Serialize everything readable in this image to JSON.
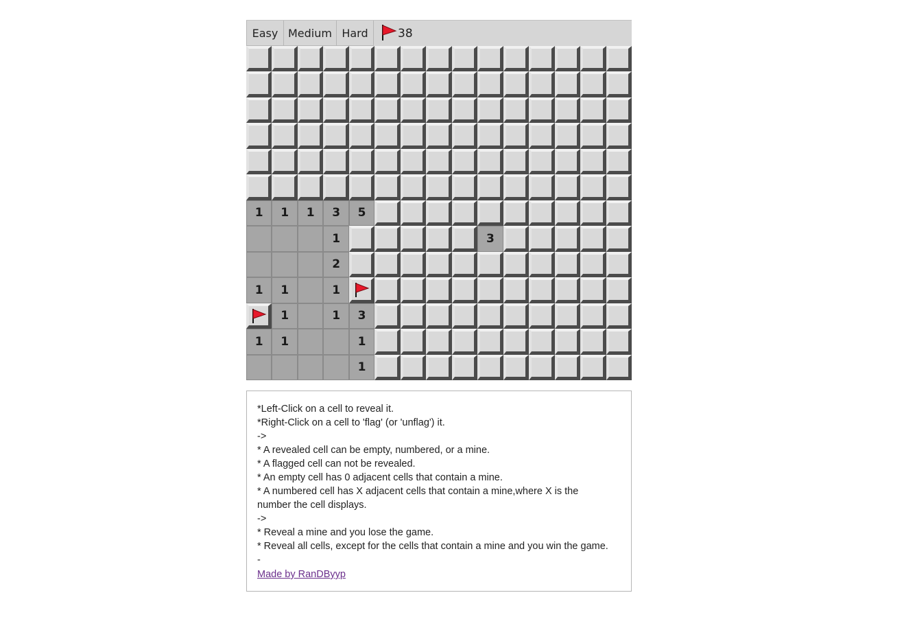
{
  "toolbar": {
    "easy_label": "Easy",
    "medium_label": "Medium",
    "hard_label": "Hard",
    "flag_count": "38",
    "flag_icon": "flag-icon"
  },
  "board": {
    "rows": 13,
    "cols": 15,
    "colors": {
      "hidden": "#d9d9d9",
      "revealed": "#a6a6a6",
      "flag": "#e8192b"
    },
    "grid": [
      [
        "H",
        "H",
        "H",
        "H",
        "H",
        "H",
        "H",
        "H",
        "H",
        "H",
        "H",
        "H",
        "H",
        "H",
        "H"
      ],
      [
        "H",
        "H",
        "H",
        "H",
        "H",
        "H",
        "H",
        "H",
        "H",
        "H",
        "H",
        "H",
        "H",
        "H",
        "H"
      ],
      [
        "H",
        "H",
        "H",
        "H",
        "H",
        "H",
        "H",
        "H",
        "H",
        "H",
        "H",
        "H",
        "H",
        "H",
        "H"
      ],
      [
        "H",
        "H",
        "H",
        "H",
        "H",
        "H",
        "H",
        "H",
        "H",
        "H",
        "H",
        "H",
        "H",
        "H",
        "H"
      ],
      [
        "H",
        "H",
        "H",
        "H",
        "H",
        "H",
        "H",
        "H",
        "H",
        "H",
        "H",
        "H",
        "H",
        "H",
        "H"
      ],
      [
        "H",
        "H",
        "H",
        "H",
        "H",
        "H",
        "H",
        "H",
        "H",
        "H",
        "H",
        "H",
        "H",
        "H",
        "H"
      ],
      [
        "1",
        "1",
        "1",
        "3",
        "5",
        "H",
        "H",
        "H",
        "H",
        "H",
        "H",
        "H",
        "H",
        "H",
        "H"
      ],
      [
        "0",
        "0",
        "0",
        "1",
        "H",
        "H",
        "H",
        "H",
        "H",
        "3",
        "H",
        "H",
        "H",
        "H",
        "H"
      ],
      [
        "0",
        "0",
        "0",
        "2",
        "H",
        "H",
        "H",
        "H",
        "H",
        "H",
        "H",
        "H",
        "H",
        "H",
        "H"
      ],
      [
        "1",
        "1",
        "0",
        "1",
        "F",
        "H",
        "H",
        "H",
        "H",
        "H",
        "H",
        "H",
        "H",
        "H",
        "H"
      ],
      [
        "F",
        "1",
        "0",
        "1",
        "3",
        "H",
        "H",
        "H",
        "H",
        "H",
        "H",
        "H",
        "H",
        "H",
        "H"
      ],
      [
        "1",
        "1",
        "0",
        "0",
        "1",
        "H",
        "H",
        "H",
        "H",
        "H",
        "H",
        "H",
        "H",
        "H",
        "H"
      ],
      [
        "0",
        "0",
        "0",
        "0",
        "1",
        "H",
        "H",
        "H",
        "H",
        "H",
        "H",
        "H",
        "H",
        "H",
        "H"
      ]
    ]
  },
  "instructions": {
    "lines": [
      "*Left-Click on a cell to reveal it.",
      "*Right-Click on a cell to 'flag' (or 'unflag') it.",
      "->",
      "* A revealed cell can be empty, numbered, or a mine.",
      "* A flagged cell can not be revealed.",
      "* An empty cell has 0 adjacent cells that contain a mine.",
      "* A numbered cell has X adjacent cells that contain a mine,where X is the",
      "number the cell displays.",
      "->",
      "* Reveal a mine and you lose the game.",
      "* Reveal all cells, except for the cells that contain a mine and you win the game.",
      "-"
    ],
    "credit_link": "Made by RanDByyp"
  }
}
